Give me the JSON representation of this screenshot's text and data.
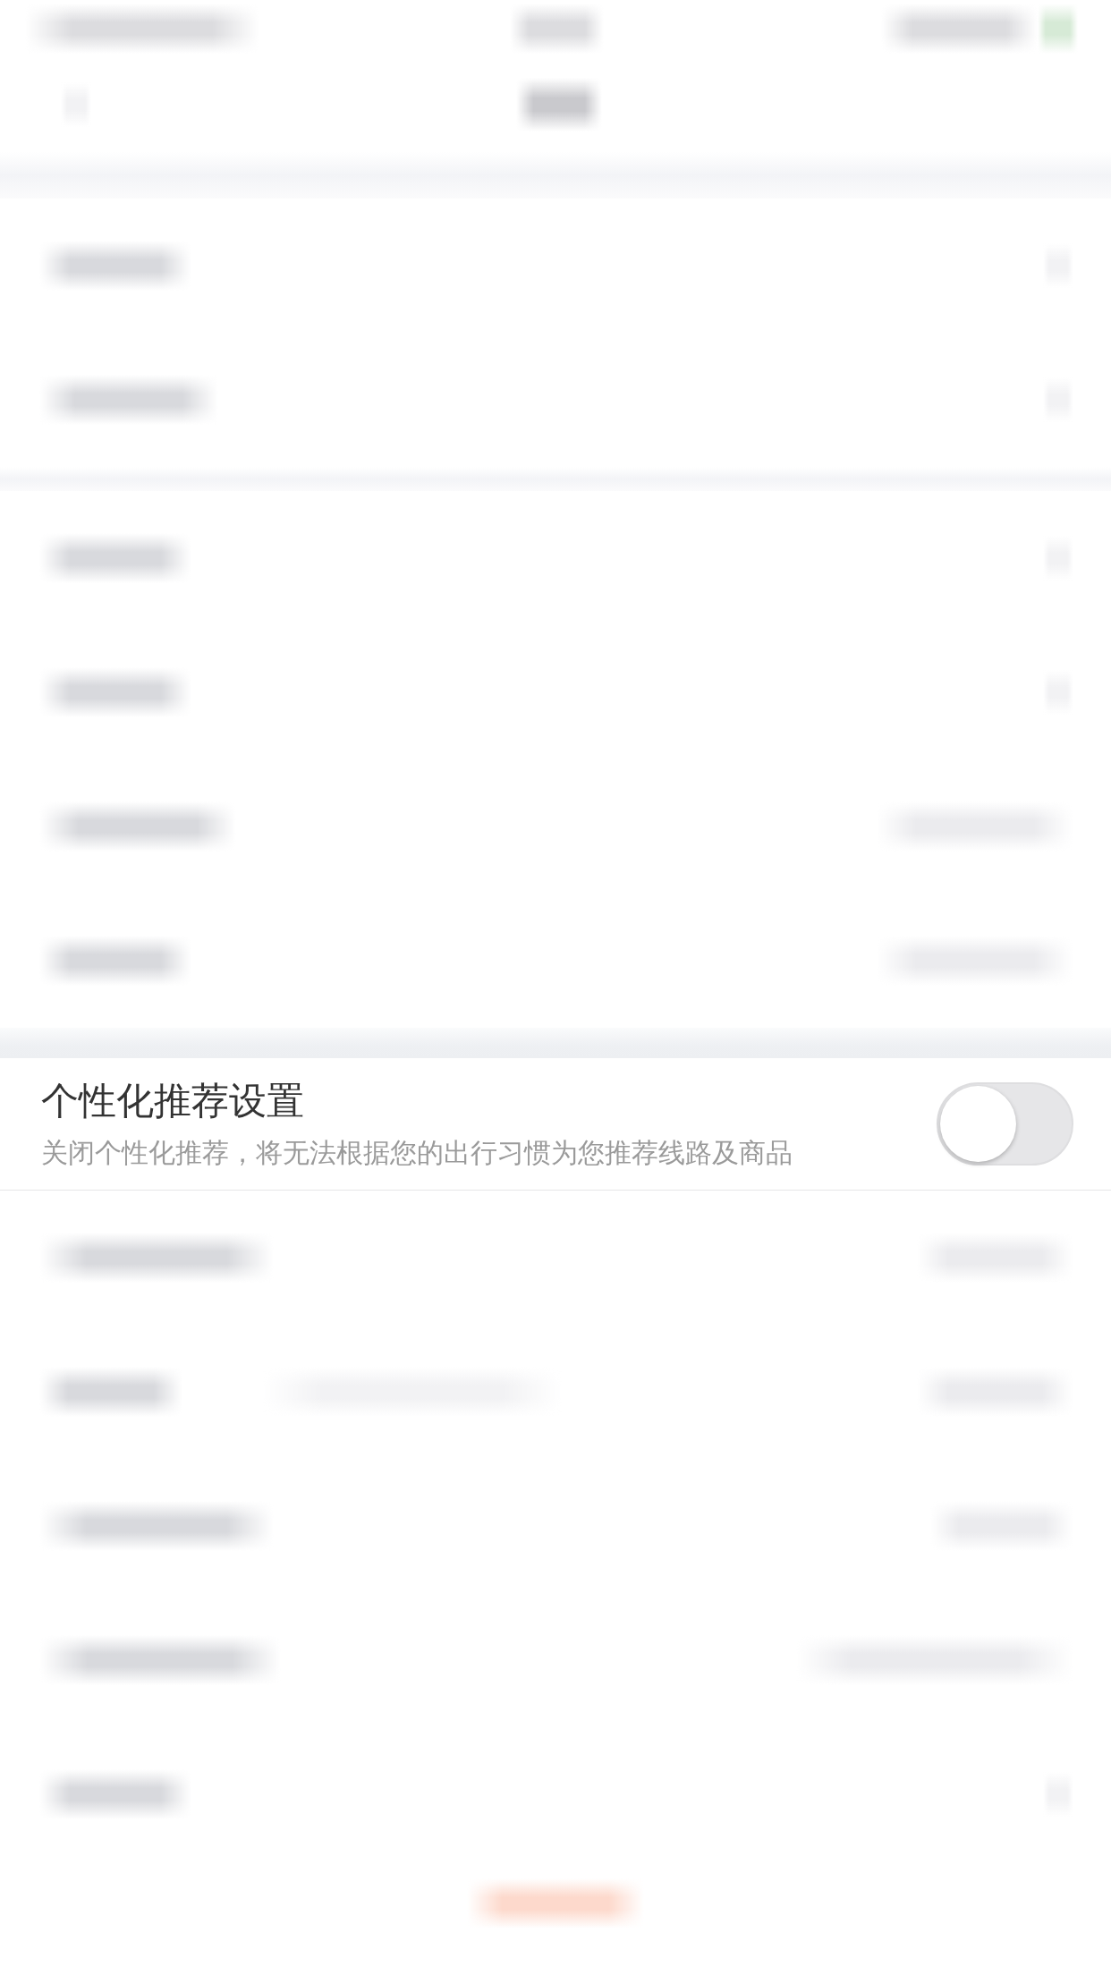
{
  "background_page": {
    "blurred": true
  },
  "setting": {
    "title": "个性化推荐设置",
    "description": "关闭个性化推荐，将无法根据您的出行习惯为您推荐线路及商品",
    "on": false
  }
}
